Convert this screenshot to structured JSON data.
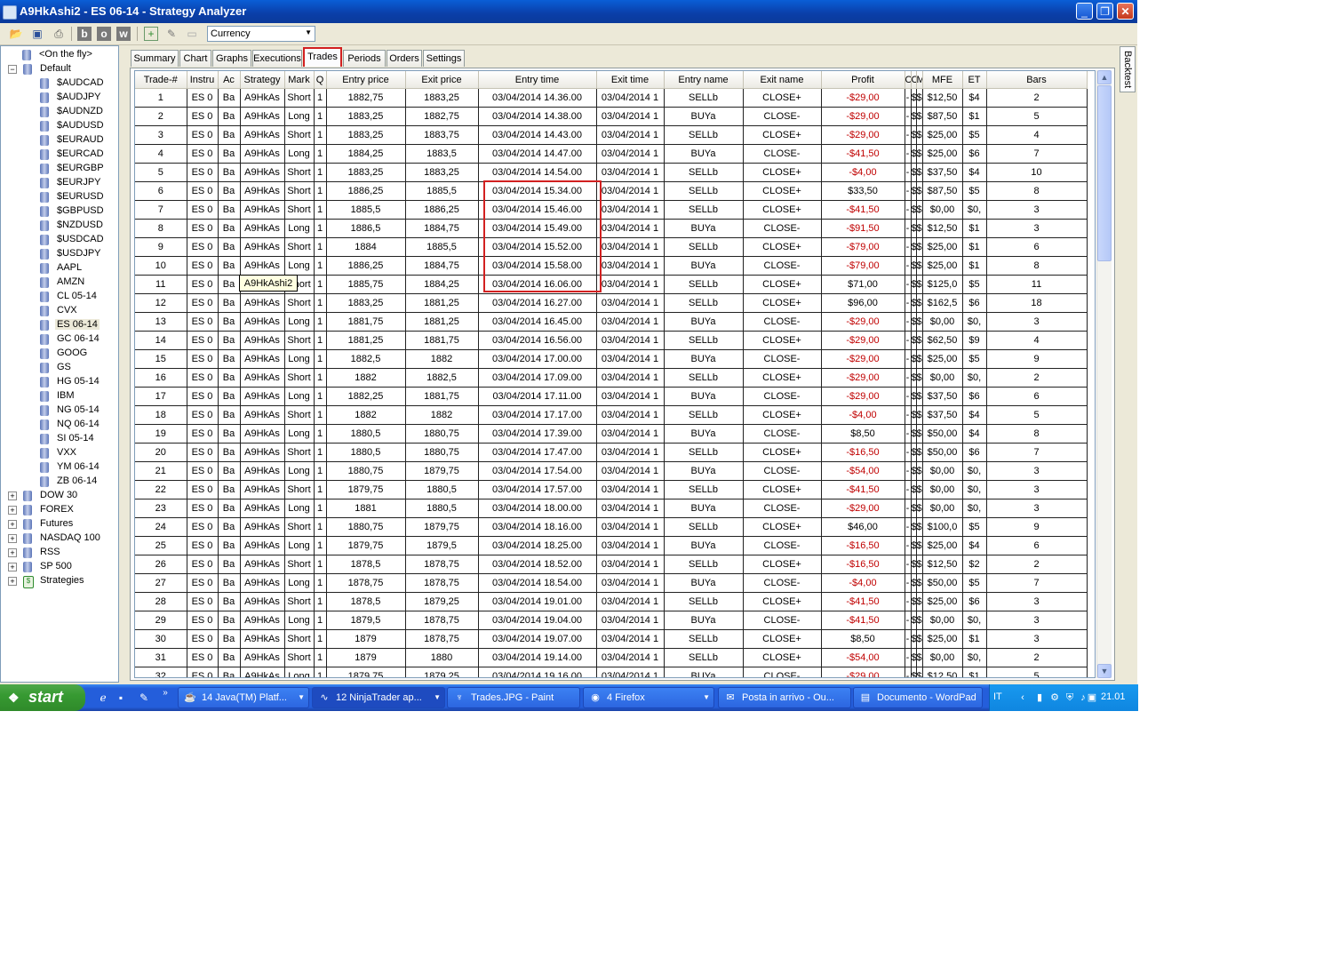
{
  "window": {
    "title": "A9HkAshi2 - ES 06-14 - Strategy Analyzer",
    "icon": "strategy-analyzer-icon"
  },
  "toolbar": {
    "currency_select": "Currency"
  },
  "tree": [
    {
      "label": "<On the fly>",
      "level": 1,
      "type": "db"
    },
    {
      "label": "Default",
      "level": 0,
      "type": "folder-open"
    },
    {
      "label": "$AUDCAD",
      "level": 2,
      "type": "db"
    },
    {
      "label": "$AUDJPY",
      "level": 2,
      "type": "db"
    },
    {
      "label": "$AUDNZD",
      "level": 2,
      "type": "db"
    },
    {
      "label": "$AUDUSD",
      "level": 2,
      "type": "db"
    },
    {
      "label": "$EURAUD",
      "level": 2,
      "type": "db"
    },
    {
      "label": "$EURCAD",
      "level": 2,
      "type": "db"
    },
    {
      "label": "$EURGBP",
      "level": 2,
      "type": "db"
    },
    {
      "label": "$EURJPY",
      "level": 2,
      "type": "db"
    },
    {
      "label": "$EURUSD",
      "level": 2,
      "type": "db"
    },
    {
      "label": "$GBPUSD",
      "level": 2,
      "type": "db"
    },
    {
      "label": "$NZDUSD",
      "level": 2,
      "type": "db"
    },
    {
      "label": "$USDCAD",
      "level": 2,
      "type": "db"
    },
    {
      "label": "$USDJPY",
      "level": 2,
      "type": "db"
    },
    {
      "label": "AAPL",
      "level": 2,
      "type": "db"
    },
    {
      "label": "AMZN",
      "level": 2,
      "type": "db"
    },
    {
      "label": "CL 05-14",
      "level": 2,
      "type": "db"
    },
    {
      "label": "CVX",
      "level": 2,
      "type": "db"
    },
    {
      "label": "ES 06-14",
      "level": 2,
      "type": "db",
      "selected": true
    },
    {
      "label": "GC 06-14",
      "level": 2,
      "type": "db"
    },
    {
      "label": "GOOG",
      "level": 2,
      "type": "db"
    },
    {
      "label": "GS",
      "level": 2,
      "type": "db"
    },
    {
      "label": "HG 05-14",
      "level": 2,
      "type": "db"
    },
    {
      "label": "IBM",
      "level": 2,
      "type": "db"
    },
    {
      "label": "NG 05-14",
      "level": 2,
      "type": "db"
    },
    {
      "label": "NQ 06-14",
      "level": 2,
      "type": "db"
    },
    {
      "label": "SI 05-14",
      "level": 2,
      "type": "db"
    },
    {
      "label": "VXX",
      "level": 2,
      "type": "db"
    },
    {
      "label": "YM 06-14",
      "level": 2,
      "type": "db"
    },
    {
      "label": "ZB 06-14",
      "level": 2,
      "type": "db"
    },
    {
      "label": "DOW 30",
      "level": 0,
      "type": "folder"
    },
    {
      "label": "FOREX",
      "level": 0,
      "type": "folder"
    },
    {
      "label": "Futures",
      "level": 0,
      "type": "folder"
    },
    {
      "label": "NASDAQ 100",
      "level": 0,
      "type": "folder"
    },
    {
      "label": "RSS",
      "level": 0,
      "type": "folder"
    },
    {
      "label": "SP 500",
      "level": 0,
      "type": "folder"
    },
    {
      "label": "Strategies",
      "level": 0,
      "type": "strategies"
    }
  ],
  "tabs": [
    "Summary",
    "Chart",
    "Graphs",
    "Executions",
    "Trades",
    "Periods",
    "Orders",
    "Settings"
  ],
  "active_tab": "Trades",
  "side_tab": "Backtest",
  "columns": [
    "Trade-#",
    "Instru",
    "Ac",
    "Strategy",
    "Mark",
    "Q",
    "Entry price",
    "Exit price",
    "Entry time",
    "Exit time",
    "Entry name",
    "Exit name",
    "Profit",
    "C",
    "C",
    "M",
    "MFE",
    "ET",
    "Bars"
  ],
  "rows": [
    [
      "1",
      "ES 0",
      "Ba",
      "A9HkAs",
      "Short",
      "1",
      "1882,75",
      "1883,25",
      "03/04/2014 14.36.00",
      "03/04/2014 1",
      "SELLb",
      "CLOSE+",
      "-$29,00",
      "-",
      "$",
      "$",
      "$12,50",
      "$4",
      "2"
    ],
    [
      "2",
      "ES 0",
      "Ba",
      "A9HkAs",
      "Long",
      "1",
      "1883,25",
      "1882,75",
      "03/04/2014 14.38.00",
      "03/04/2014 1",
      "BUYa",
      "CLOSE-",
      "-$29,00",
      "-",
      "$",
      "$",
      "$87,50",
      "$1",
      "5"
    ],
    [
      "3",
      "ES 0",
      "Ba",
      "A9HkAs",
      "Short",
      "1",
      "1883,25",
      "1883,75",
      "03/04/2014 14.43.00",
      "03/04/2014 1",
      "SELLb",
      "CLOSE+",
      "-$29,00",
      "-",
      "$",
      "$",
      "$25,00",
      "$5",
      "4"
    ],
    [
      "4",
      "ES 0",
      "Ba",
      "A9HkAs",
      "Long",
      "1",
      "1884,25",
      "1883,5",
      "03/04/2014 14.47.00",
      "03/04/2014 1",
      "BUYa",
      "CLOSE-",
      "-$41,50",
      "-",
      "$",
      "$",
      "$25,00",
      "$6",
      "7"
    ],
    [
      "5",
      "ES 0",
      "Ba",
      "A9HkAs",
      "Short",
      "1",
      "1883,25",
      "1883,25",
      "03/04/2014 14.54.00",
      "03/04/2014 1",
      "SELLb",
      "CLOSE+",
      "-$4,00",
      "-",
      "$",
      "$",
      "$37,50",
      "$4",
      "10"
    ],
    [
      "6",
      "ES 0",
      "Ba",
      "A9HkAs",
      "Short",
      "1",
      "1886,25",
      "1885,5",
      "03/04/2014 15.34.00",
      "03/04/2014 1",
      "SELLb",
      "CLOSE+",
      "$33,50",
      "-",
      "$",
      "$",
      "$87,50",
      "$5",
      "8"
    ],
    [
      "7",
      "ES 0",
      "Ba",
      "A9HkAs",
      "Short",
      "1",
      "1885,5",
      "1886,25",
      "03/04/2014 15.46.00",
      "03/04/2014 1",
      "SELLb",
      "CLOSE+",
      "-$41,50",
      "-",
      "$",
      "$",
      "$0,00",
      "$0,",
      "3"
    ],
    [
      "8",
      "ES 0",
      "Ba",
      "A9HkAs",
      "Long",
      "1",
      "1886,5",
      "1884,75",
      "03/04/2014 15.49.00",
      "03/04/2014 1",
      "BUYa",
      "CLOSE-",
      "-$91,50",
      "-",
      "$",
      "$",
      "$12,50",
      "$1",
      "3"
    ],
    [
      "9",
      "ES 0",
      "Ba",
      "A9HkAs",
      "Short",
      "1",
      "1884",
      "1885,5",
      "03/04/2014 15.52.00",
      "03/04/2014 1",
      "SELLb",
      "CLOSE+",
      "-$79,00",
      "-",
      "$",
      "$",
      "$25,00",
      "$1",
      "6"
    ],
    [
      "10",
      "ES 0",
      "Ba",
      "A9HkAs",
      "Long",
      "1",
      "1886,25",
      "1884,75",
      "03/04/2014 15.58.00",
      "03/04/2014 1",
      "BUYa",
      "CLOSE-",
      "-$79,00",
      "-",
      "$",
      "$",
      "$25,00",
      "$1",
      "8"
    ],
    [
      "11",
      "ES 0",
      "Ba",
      "A9HkAs",
      "Short",
      "1",
      "1885,75",
      "1884,25",
      "03/04/2014 16.06.00",
      "03/04/2014 1",
      "SELLb",
      "CLOSE+",
      "$71,00",
      "-",
      "$",
      "$",
      "$125,0",
      "$5",
      "11"
    ],
    [
      "12",
      "ES 0",
      "Ba",
      "A9HkAs",
      "Short",
      "1",
      "1883,25",
      "1881,25",
      "03/04/2014 16.27.00",
      "03/04/2014 1",
      "SELLb",
      "CLOSE+",
      "$96,00",
      "-",
      "$",
      "$",
      "$162,5",
      "$6",
      "18"
    ],
    [
      "13",
      "ES 0",
      "Ba",
      "A9HkAs",
      "Long",
      "1",
      "1881,75",
      "1881,25",
      "03/04/2014 16.45.00",
      "03/04/2014 1",
      "BUYa",
      "CLOSE-",
      "-$29,00",
      "-",
      "$",
      "$",
      "$0,00",
      "$0,",
      "3"
    ],
    [
      "14",
      "ES 0",
      "Ba",
      "A9HkAs",
      "Short",
      "1",
      "1881,25",
      "1881,75",
      "03/04/2014 16.56.00",
      "03/04/2014 1",
      "SELLb",
      "CLOSE+",
      "-$29,00",
      "-",
      "$",
      "$",
      "$62,50",
      "$9",
      "4"
    ],
    [
      "15",
      "ES 0",
      "Ba",
      "A9HkAs",
      "Long",
      "1",
      "1882,5",
      "1882",
      "03/04/2014 17.00.00",
      "03/04/2014 1",
      "BUYa",
      "CLOSE-",
      "-$29,00",
      "-",
      "$",
      "$",
      "$25,00",
      "$5",
      "9"
    ],
    [
      "16",
      "ES 0",
      "Ba",
      "A9HkAs",
      "Short",
      "1",
      "1882",
      "1882,5",
      "03/04/2014 17.09.00",
      "03/04/2014 1",
      "SELLb",
      "CLOSE+",
      "-$29,00",
      "-",
      "$",
      "$",
      "$0,00",
      "$0,",
      "2"
    ],
    [
      "17",
      "ES 0",
      "Ba",
      "A9HkAs",
      "Long",
      "1",
      "1882,25",
      "1881,75",
      "03/04/2014 17.11.00",
      "03/04/2014 1",
      "BUYa",
      "CLOSE-",
      "-$29,00",
      "-",
      "$",
      "$",
      "$37,50",
      "$6",
      "6"
    ],
    [
      "18",
      "ES 0",
      "Ba",
      "A9HkAs",
      "Short",
      "1",
      "1882",
      "1882",
      "03/04/2014 17.17.00",
      "03/04/2014 1",
      "SELLb",
      "CLOSE+",
      "-$4,00",
      "-",
      "$",
      "$",
      "$37,50",
      "$4",
      "5"
    ],
    [
      "19",
      "ES 0",
      "Ba",
      "A9HkAs",
      "Long",
      "1",
      "1880,5",
      "1880,75",
      "03/04/2014 17.39.00",
      "03/04/2014 1",
      "BUYa",
      "CLOSE-",
      "$8,50",
      "-",
      "$",
      "$",
      "$50,00",
      "$4",
      "8"
    ],
    [
      "20",
      "ES 0",
      "Ba",
      "A9HkAs",
      "Short",
      "1",
      "1880,5",
      "1880,75",
      "03/04/2014 17.47.00",
      "03/04/2014 1",
      "SELLb",
      "CLOSE+",
      "-$16,50",
      "-",
      "$",
      "$",
      "$50,00",
      "$6",
      "7"
    ],
    [
      "21",
      "ES 0",
      "Ba",
      "A9HkAs",
      "Long",
      "1",
      "1880,75",
      "1879,75",
      "03/04/2014 17.54.00",
      "03/04/2014 1",
      "BUYa",
      "CLOSE-",
      "-$54,00",
      "-",
      "$",
      "$",
      "$0,00",
      "$0,",
      "3"
    ],
    [
      "22",
      "ES 0",
      "Ba",
      "A9HkAs",
      "Short",
      "1",
      "1879,75",
      "1880,5",
      "03/04/2014 17.57.00",
      "03/04/2014 1",
      "SELLb",
      "CLOSE+",
      "-$41,50",
      "-",
      "$",
      "$",
      "$0,00",
      "$0,",
      "3"
    ],
    [
      "23",
      "ES 0",
      "Ba",
      "A9HkAs",
      "Long",
      "1",
      "1881",
      "1880,5",
      "03/04/2014 18.00.00",
      "03/04/2014 1",
      "BUYa",
      "CLOSE-",
      "-$29,00",
      "-",
      "$",
      "$",
      "$0,00",
      "$0,",
      "3"
    ],
    [
      "24",
      "ES 0",
      "Ba",
      "A9HkAs",
      "Short",
      "1",
      "1880,75",
      "1879,75",
      "03/04/2014 18.16.00",
      "03/04/2014 1",
      "SELLb",
      "CLOSE+",
      "$46,00",
      "-",
      "$",
      "$",
      "$100,0",
      "$5",
      "9"
    ],
    [
      "25",
      "ES 0",
      "Ba",
      "A9HkAs",
      "Long",
      "1",
      "1879,75",
      "1879,5",
      "03/04/2014 18.25.00",
      "03/04/2014 1",
      "BUYa",
      "CLOSE-",
      "-$16,50",
      "-",
      "$",
      "$",
      "$25,00",
      "$4",
      "6"
    ],
    [
      "26",
      "ES 0",
      "Ba",
      "A9HkAs",
      "Short",
      "1",
      "1878,5",
      "1878,75",
      "03/04/2014 18.52.00",
      "03/04/2014 1",
      "SELLb",
      "CLOSE+",
      "-$16,50",
      "-",
      "$",
      "$",
      "$12,50",
      "$2",
      "2"
    ],
    [
      "27",
      "ES 0",
      "Ba",
      "A9HkAs",
      "Long",
      "1",
      "1878,75",
      "1878,75",
      "03/04/2014 18.54.00",
      "03/04/2014 1",
      "BUYa",
      "CLOSE-",
      "-$4,00",
      "-",
      "$",
      "$",
      "$50,00",
      "$5",
      "7"
    ],
    [
      "28",
      "ES 0",
      "Ba",
      "A9HkAs",
      "Short",
      "1",
      "1878,5",
      "1879,25",
      "03/04/2014 19.01.00",
      "03/04/2014 1",
      "SELLb",
      "CLOSE+",
      "-$41,50",
      "-",
      "$",
      "$",
      "$25,00",
      "$6",
      "3"
    ],
    [
      "29",
      "ES 0",
      "Ba",
      "A9HkAs",
      "Long",
      "1",
      "1879,5",
      "1878,75",
      "03/04/2014 19.04.00",
      "03/04/2014 1",
      "BUYa",
      "CLOSE-",
      "-$41,50",
      "-",
      "$",
      "$",
      "$0,00",
      "$0,",
      "3"
    ],
    [
      "30",
      "ES 0",
      "Ba",
      "A9HkAs",
      "Short",
      "1",
      "1879",
      "1878,75",
      "03/04/2014 19.07.00",
      "03/04/2014 1",
      "SELLb",
      "CLOSE+",
      "$8,50",
      "-",
      "$",
      "$",
      "$25,00",
      "$1",
      "3"
    ],
    [
      "31",
      "ES 0",
      "Ba",
      "A9HkAs",
      "Short",
      "1",
      "1879",
      "1880",
      "03/04/2014 19.14.00",
      "03/04/2014 1",
      "SELLb",
      "CLOSE+",
      "-$54,00",
      "-",
      "$",
      "$",
      "$0,00",
      "$0,",
      "2"
    ],
    [
      "32",
      "ES 0",
      "Ba",
      "A9HkAs",
      "Long",
      "1",
      "1879,75",
      "1879,25",
      "03/04/2014 19.16.00",
      "03/04/2014 1",
      "BUYa",
      "CLOSE-",
      "-$29,00",
      "-",
      "$",
      "$",
      "$12,50",
      "$1",
      "5"
    ]
  ],
  "tooltip": "A9HkAshi2",
  "colors": {
    "negative_profit": "#c00000",
    "highlight_box": "#d22020",
    "taskbar": "#245edb",
    "start_button": "#379a32"
  },
  "taskbar": {
    "start_label": "start",
    "tasks": [
      {
        "label": "14 Java(TM) Platf...",
        "icon": "java-icon",
        "caret": true
      },
      {
        "label": "12 NinjaTrader ap...",
        "icon": "ninjatrader-icon",
        "caret": true,
        "active": true
      },
      {
        "label": "Trades.JPG - Paint",
        "icon": "paint-icon"
      },
      {
        "label": "4 Firefox",
        "icon": "firefox-icon",
        "caret": true
      },
      {
        "label": "Posta in arrivo - Ou...",
        "icon": "outlook-icon"
      },
      {
        "label": "Documento - WordPad",
        "icon": "wordpad-icon"
      }
    ],
    "language": "IT",
    "clock": "21.01"
  }
}
